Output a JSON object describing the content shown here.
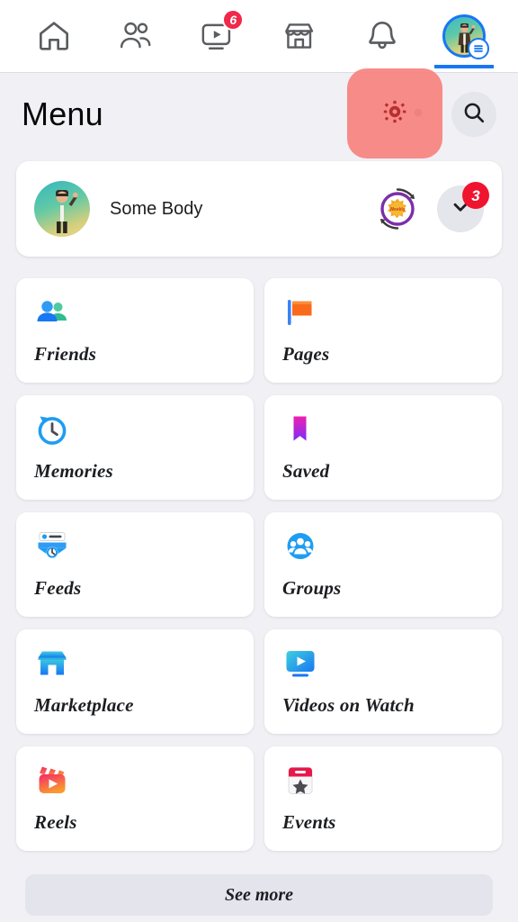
{
  "topnav": {
    "items": [
      {
        "name": "home",
        "icon": "home-icon",
        "badge": null,
        "active": false
      },
      {
        "name": "friends",
        "icon": "friends-icon",
        "badge": null,
        "active": false
      },
      {
        "name": "watch",
        "icon": "watch-icon",
        "badge": "6",
        "active": false
      },
      {
        "name": "marketplace",
        "icon": "marketplace-icon",
        "badge": null,
        "active": false
      },
      {
        "name": "notifications",
        "icon": "bell-icon",
        "badge": null,
        "active": false
      },
      {
        "name": "menu",
        "icon": "profile-avatar-icon",
        "badge": null,
        "active": true
      }
    ]
  },
  "header": {
    "title": "Menu",
    "settings_icon": "gear-icon",
    "search_icon": "search-icon",
    "highlight_color": "#f8837f"
  },
  "profile": {
    "name": "Some Body",
    "avatar_icon": "user-avatar",
    "badge_icon": "rotating-star-badge-icon",
    "expand_icon": "chevron-down-icon",
    "notification_count": "3",
    "notification_color": "#f0142f"
  },
  "menu": {
    "tiles": [
      {
        "label": "Friends",
        "icon": "friends-icon"
      },
      {
        "label": "Pages",
        "icon": "flag-icon"
      },
      {
        "label": "Memories",
        "icon": "clock-history-icon"
      },
      {
        "label": "Saved",
        "icon": "bookmark-icon"
      },
      {
        "label": "Feeds",
        "icon": "feeds-icon"
      },
      {
        "label": "Groups",
        "icon": "groups-icon"
      },
      {
        "label": "Marketplace",
        "icon": "storefront-icon"
      },
      {
        "label": "Videos on Watch",
        "icon": "video-monitor-icon"
      },
      {
        "label": "Reels",
        "icon": "clapperboard-icon"
      },
      {
        "label": "Events",
        "icon": "calendar-star-icon"
      }
    ]
  },
  "footer": {
    "see_more_label": "See more"
  },
  "colors": {
    "page_background": "#f0f0f5",
    "card": "#ffffff",
    "brand_blue": "#1877f2",
    "badge_red": "#f02849",
    "highlight_salmon": "#f8837f"
  }
}
